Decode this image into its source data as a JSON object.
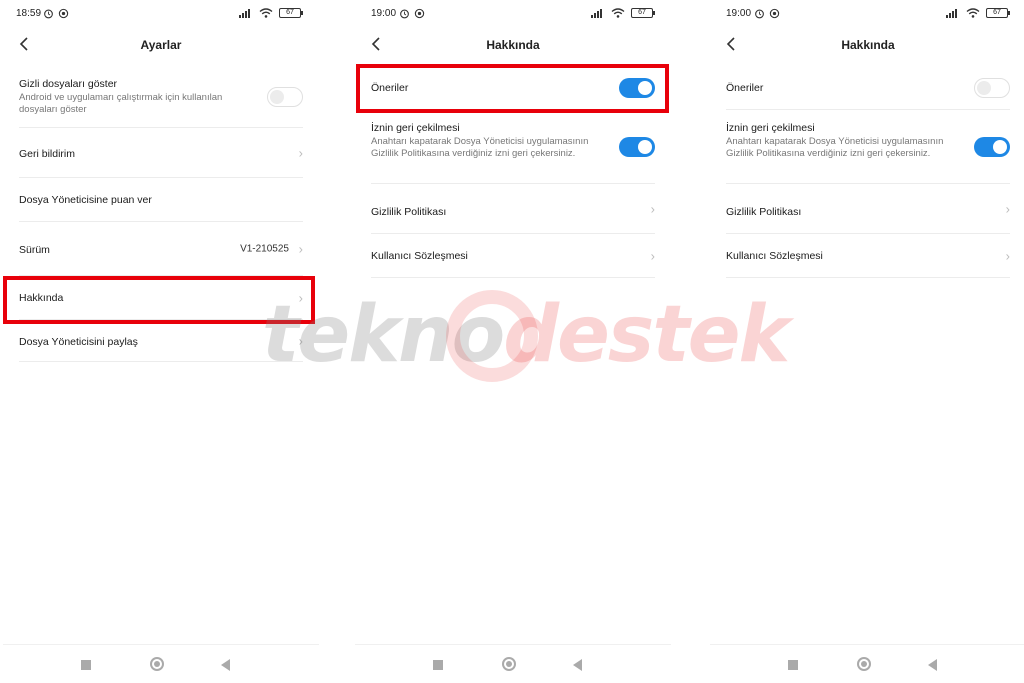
{
  "screens": [
    {
      "status": {
        "time": "18:59",
        "battery": "67"
      },
      "header": {
        "title": "Ayarlar"
      },
      "rows": [
        {
          "title": "Gizli dosyaları göster",
          "subtitle": "Android ve uygulamarı çalıştırmak için kullanılan dosyaları göster",
          "toggle": "off"
        },
        {
          "title": "Geri bildirim"
        },
        {
          "title": "Dosya Yöneticisine puan ver"
        },
        {
          "title": "Sürüm",
          "value": "V1-210525"
        },
        {
          "title": "Hakkında"
        },
        {
          "title": "Dosya Yöneticisini paylaş"
        }
      ]
    },
    {
      "status": {
        "time": "19:00",
        "battery": "67"
      },
      "header": {
        "title": "Hakkında"
      },
      "rows": [
        {
          "title": "Öneriler",
          "toggle": "on"
        },
        {
          "title": "İznin geri çekilmesi",
          "subtitle": "Anahtarı kapatarak Dosya Yöneticisi uygulamasının Gizlilik Politikasına verdiğiniz izni geri çekersiniz.",
          "toggle": "on"
        },
        {
          "title": "Gizlilik Politikası"
        },
        {
          "title": "Kullanıcı Sözleşmesi"
        }
      ]
    },
    {
      "status": {
        "time": "19:00",
        "battery": "67"
      },
      "header": {
        "title": "Hakkında"
      },
      "rows": [
        {
          "title": "Öneriler",
          "toggle": "off"
        },
        {
          "title": "İznin geri çekilmesi",
          "subtitle": "Anahtarı kapatarak Dosya Yöneticisi uygulamasının Gizlilik Politikasına verdiğiniz izni geri çekersiniz.",
          "toggle": "on"
        },
        {
          "title": "Gizlilik Politikası"
        },
        {
          "title": "Kullanıcı Sözleşmesi"
        }
      ]
    }
  ],
  "watermark": {
    "part1": "tekno",
    "part2": "destek"
  },
  "colors": {
    "toggle_on": "#1e88e5",
    "highlight": "#e8000a"
  },
  "icons": [
    "back-arrow-icon",
    "chevron-right-icon",
    "alarm-icon",
    "signal-icon",
    "wifi-icon",
    "battery-icon",
    "recents-icon",
    "home-icon",
    "back-icon"
  ]
}
